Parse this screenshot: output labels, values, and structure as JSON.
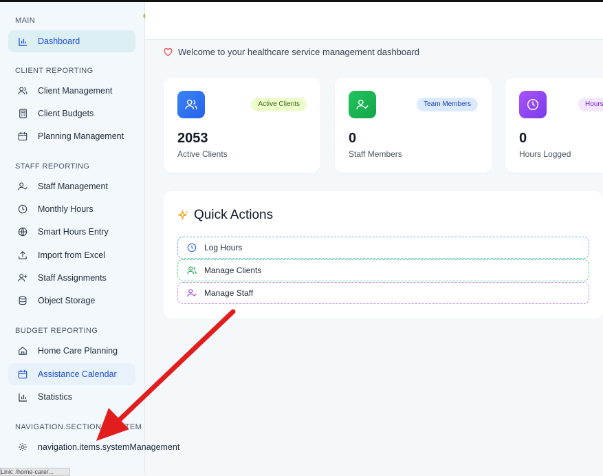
{
  "logo_fragment": "e",
  "sidebar": {
    "sections": [
      {
        "title": "MAIN"
      },
      {
        "title": "CLIENT REPORTING"
      },
      {
        "title": "STAFF REPORTING"
      },
      {
        "title": "BUDGET REPORTING"
      },
      {
        "title": "NAVIGATION.SECTIONS.SYSTEM"
      }
    ],
    "items": [
      {
        "label": "Dashboard",
        "icon": "bar-chart-icon"
      },
      {
        "label": "Client Management",
        "icon": "users-icon"
      },
      {
        "label": "Client Budgets",
        "icon": "calculator-icon"
      },
      {
        "label": "Planning Management",
        "icon": "calendar-icon"
      },
      {
        "label": "Staff Management",
        "icon": "user-check-icon"
      },
      {
        "label": "Monthly Hours",
        "icon": "clock-icon"
      },
      {
        "label": "Smart Hours Entry",
        "icon": "globe-icon"
      },
      {
        "label": "Import from Excel",
        "icon": "upload-icon"
      },
      {
        "label": "Staff Assignments",
        "icon": "user-plus-icon"
      },
      {
        "label": "Object Storage",
        "icon": "database-icon"
      },
      {
        "label": "Home Care Planning",
        "icon": "home-icon"
      },
      {
        "label": "Assistance Calendar",
        "icon": "calendar-icon"
      },
      {
        "label": "Statistics",
        "icon": "bar-chart-icon"
      },
      {
        "label": "navigation.items.systemManagement",
        "icon": "gear-icon"
      }
    ]
  },
  "welcome_text": "Welcome to your healthcare service management dashboard",
  "stats": [
    {
      "value": "2053",
      "label": "Active Clients",
      "badge": "Active Clients",
      "icon": "users-icon",
      "color": "#3b82f6"
    },
    {
      "value": "0",
      "label": "Staff Members",
      "badge": "Team Members",
      "icon": "user-check-icon",
      "color": "#22c55e"
    },
    {
      "value": "0",
      "label": "Hours Logged",
      "badge": "Hours",
      "icon": "clock-icon",
      "color": "#a855f7"
    }
  ],
  "quick_actions": {
    "title": "Quick Actions",
    "items": [
      {
        "label": "Log Hours",
        "icon": "clock-icon",
        "color": "#60a5fa"
      },
      {
        "label": "Manage Clients",
        "icon": "users-icon",
        "color": "#4ade80"
      },
      {
        "label": "Manage Staff",
        "icon": "user-check-icon",
        "color": "#c084fc"
      }
    ]
  },
  "status_tip": "Link: /home-care/..."
}
